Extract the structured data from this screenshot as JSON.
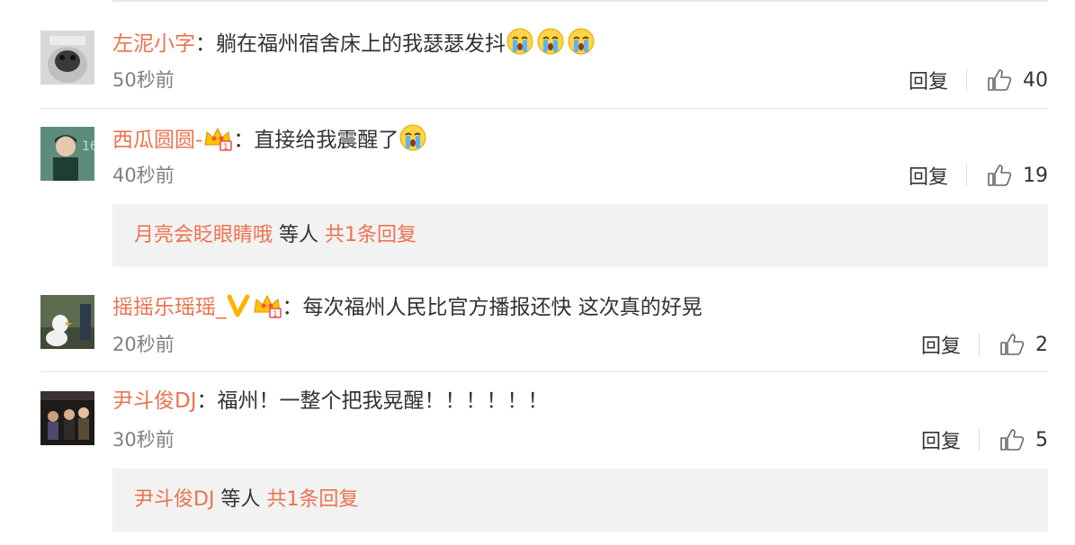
{
  "colors": {
    "accent": "#eb7350",
    "muted": "#808080",
    "reply_bg": "#f2f2f2"
  },
  "comments": [
    {
      "user": "左泥小字",
      "sep": "：",
      "text": "躺在福州宿舍床上的我瑟瑟发抖",
      "emojis": [
        "crying-emoji",
        "crying-emoji",
        "crying-emoji"
      ],
      "time": "50秒前",
      "reply_label": "回复",
      "likes": "40",
      "avatar": "pug-avatar"
    },
    {
      "user": "西瓜圆圆-",
      "sep": "：",
      "text": "直接给我震醒了",
      "emojis": [
        "crying-emoji"
      ],
      "badges": [
        "crown-member-icon"
      ],
      "time": "40秒前",
      "reply_label": "回复",
      "likes": "19",
      "avatar": "person-avatar"
    },
    {
      "user": "摇摇乐瑶瑶_",
      "sep": "：",
      "text": "每次福州人民比官方播报还快 这次真的好晃",
      "badges": [
        "verified-v-icon",
        "crown-member-icon"
      ],
      "time": "20秒前",
      "reply_label": "回复",
      "likes": "2",
      "avatar": "duck-avatar"
    },
    {
      "user": "尹斗俊DJ",
      "sep": "：",
      "text": "福州！一整个把我晃醒！！！！！！",
      "time": "30秒前",
      "reply_label": "回复",
      "likes": "5",
      "avatar": "group-avatar"
    }
  ],
  "reply_boxes": [
    {
      "user": "月亮会眨眼睛哦",
      "middle": " 等人 ",
      "count": "共1条回复"
    },
    {
      "user": "尹斗俊DJ",
      "middle": " 等人 ",
      "count": "共1条回复"
    }
  ]
}
